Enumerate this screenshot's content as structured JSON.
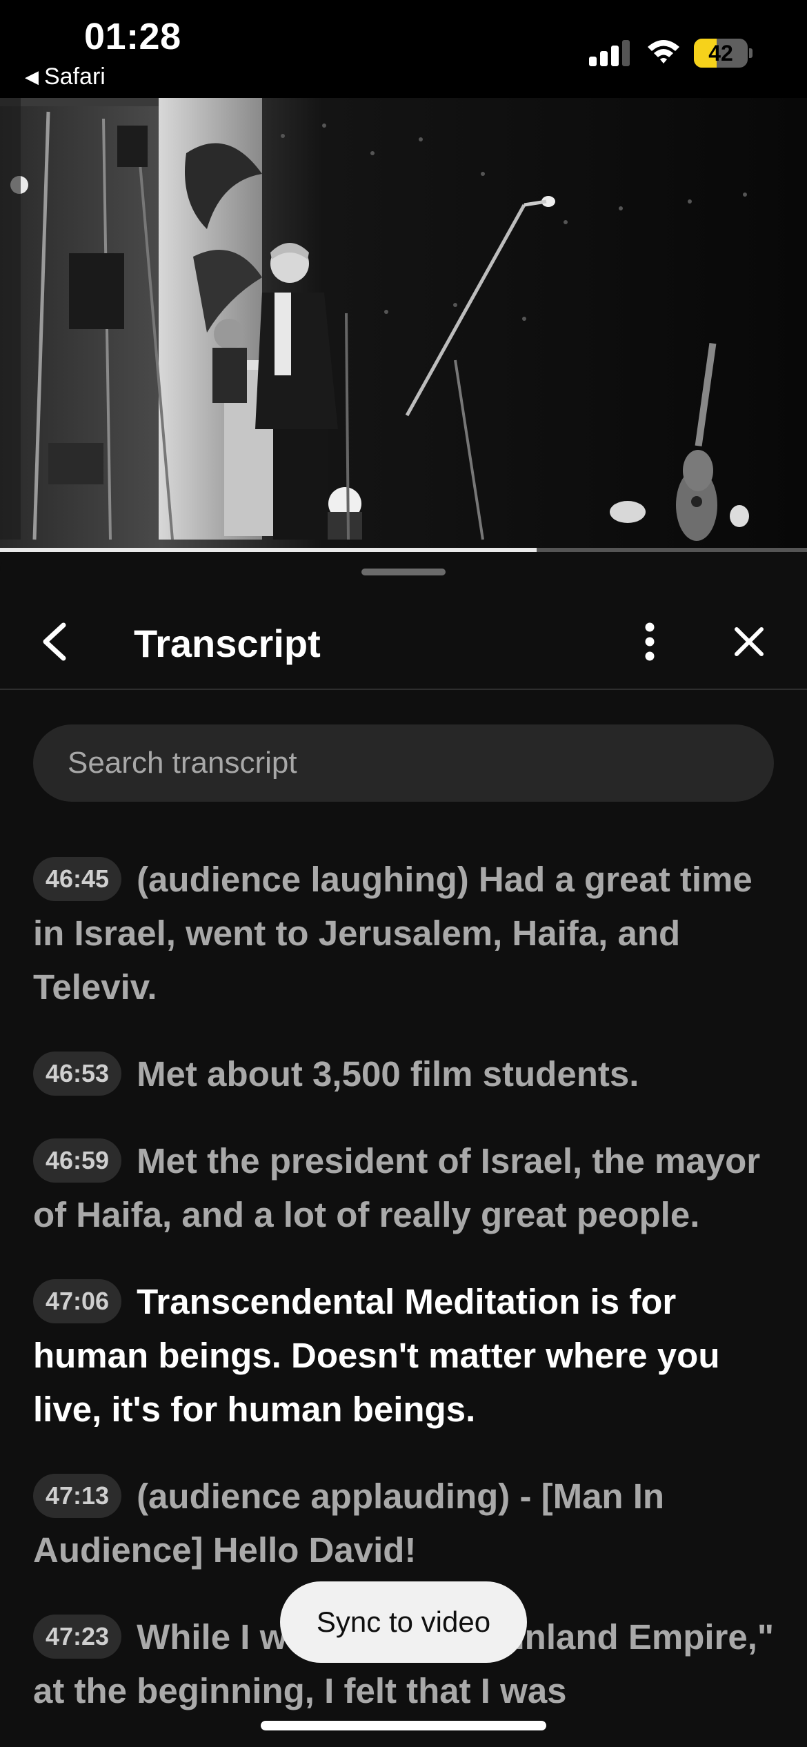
{
  "status_bar": {
    "time": "01:28",
    "back_app": "Safari",
    "battery_level": "42",
    "battery_percent": 42,
    "icons": [
      "signal-icon",
      "wifi-icon",
      "battery-icon"
    ]
  },
  "video": {
    "progress_fraction": 0.665
  },
  "sheet": {
    "title": "Transcript",
    "search_placeholder": "Search transcript",
    "icons": [
      "back-chevron-icon",
      "more-vert-icon",
      "close-icon"
    ]
  },
  "transcript": [
    {
      "time": "46:45",
      "text": "(audience laughing) Had a great time in Israel, went to Jerusalem, Haifa, and Televiv.",
      "active": false
    },
    {
      "time": "46:53",
      "text": "Met about 3,500 film students.",
      "active": false
    },
    {
      "time": "46:59",
      "text": "Met the president of Israel, the mayor of Haifa, and a lot of really great people.",
      "active": false
    },
    {
      "time": "47:06",
      "text": "Transcendental Meditation is for human beings. Doesn't matter where you live, it's for human beings.",
      "active": true
    },
    {
      "time": "47:13",
      "text": "(audience applauding) - [Man In Audience] Hello David!",
      "active": false
    },
    {
      "time": "47:23",
      "text": "While I was watching \"Inland Empire,\" at the beginning, I felt that I was",
      "active": false
    }
  ],
  "sync_label": "Sync to video",
  "colors": {
    "background": "#0f0f0f",
    "battery_fill": "#f6d21b",
    "active_text": "#ffffff",
    "inactive_text": "#a9a9a9"
  }
}
